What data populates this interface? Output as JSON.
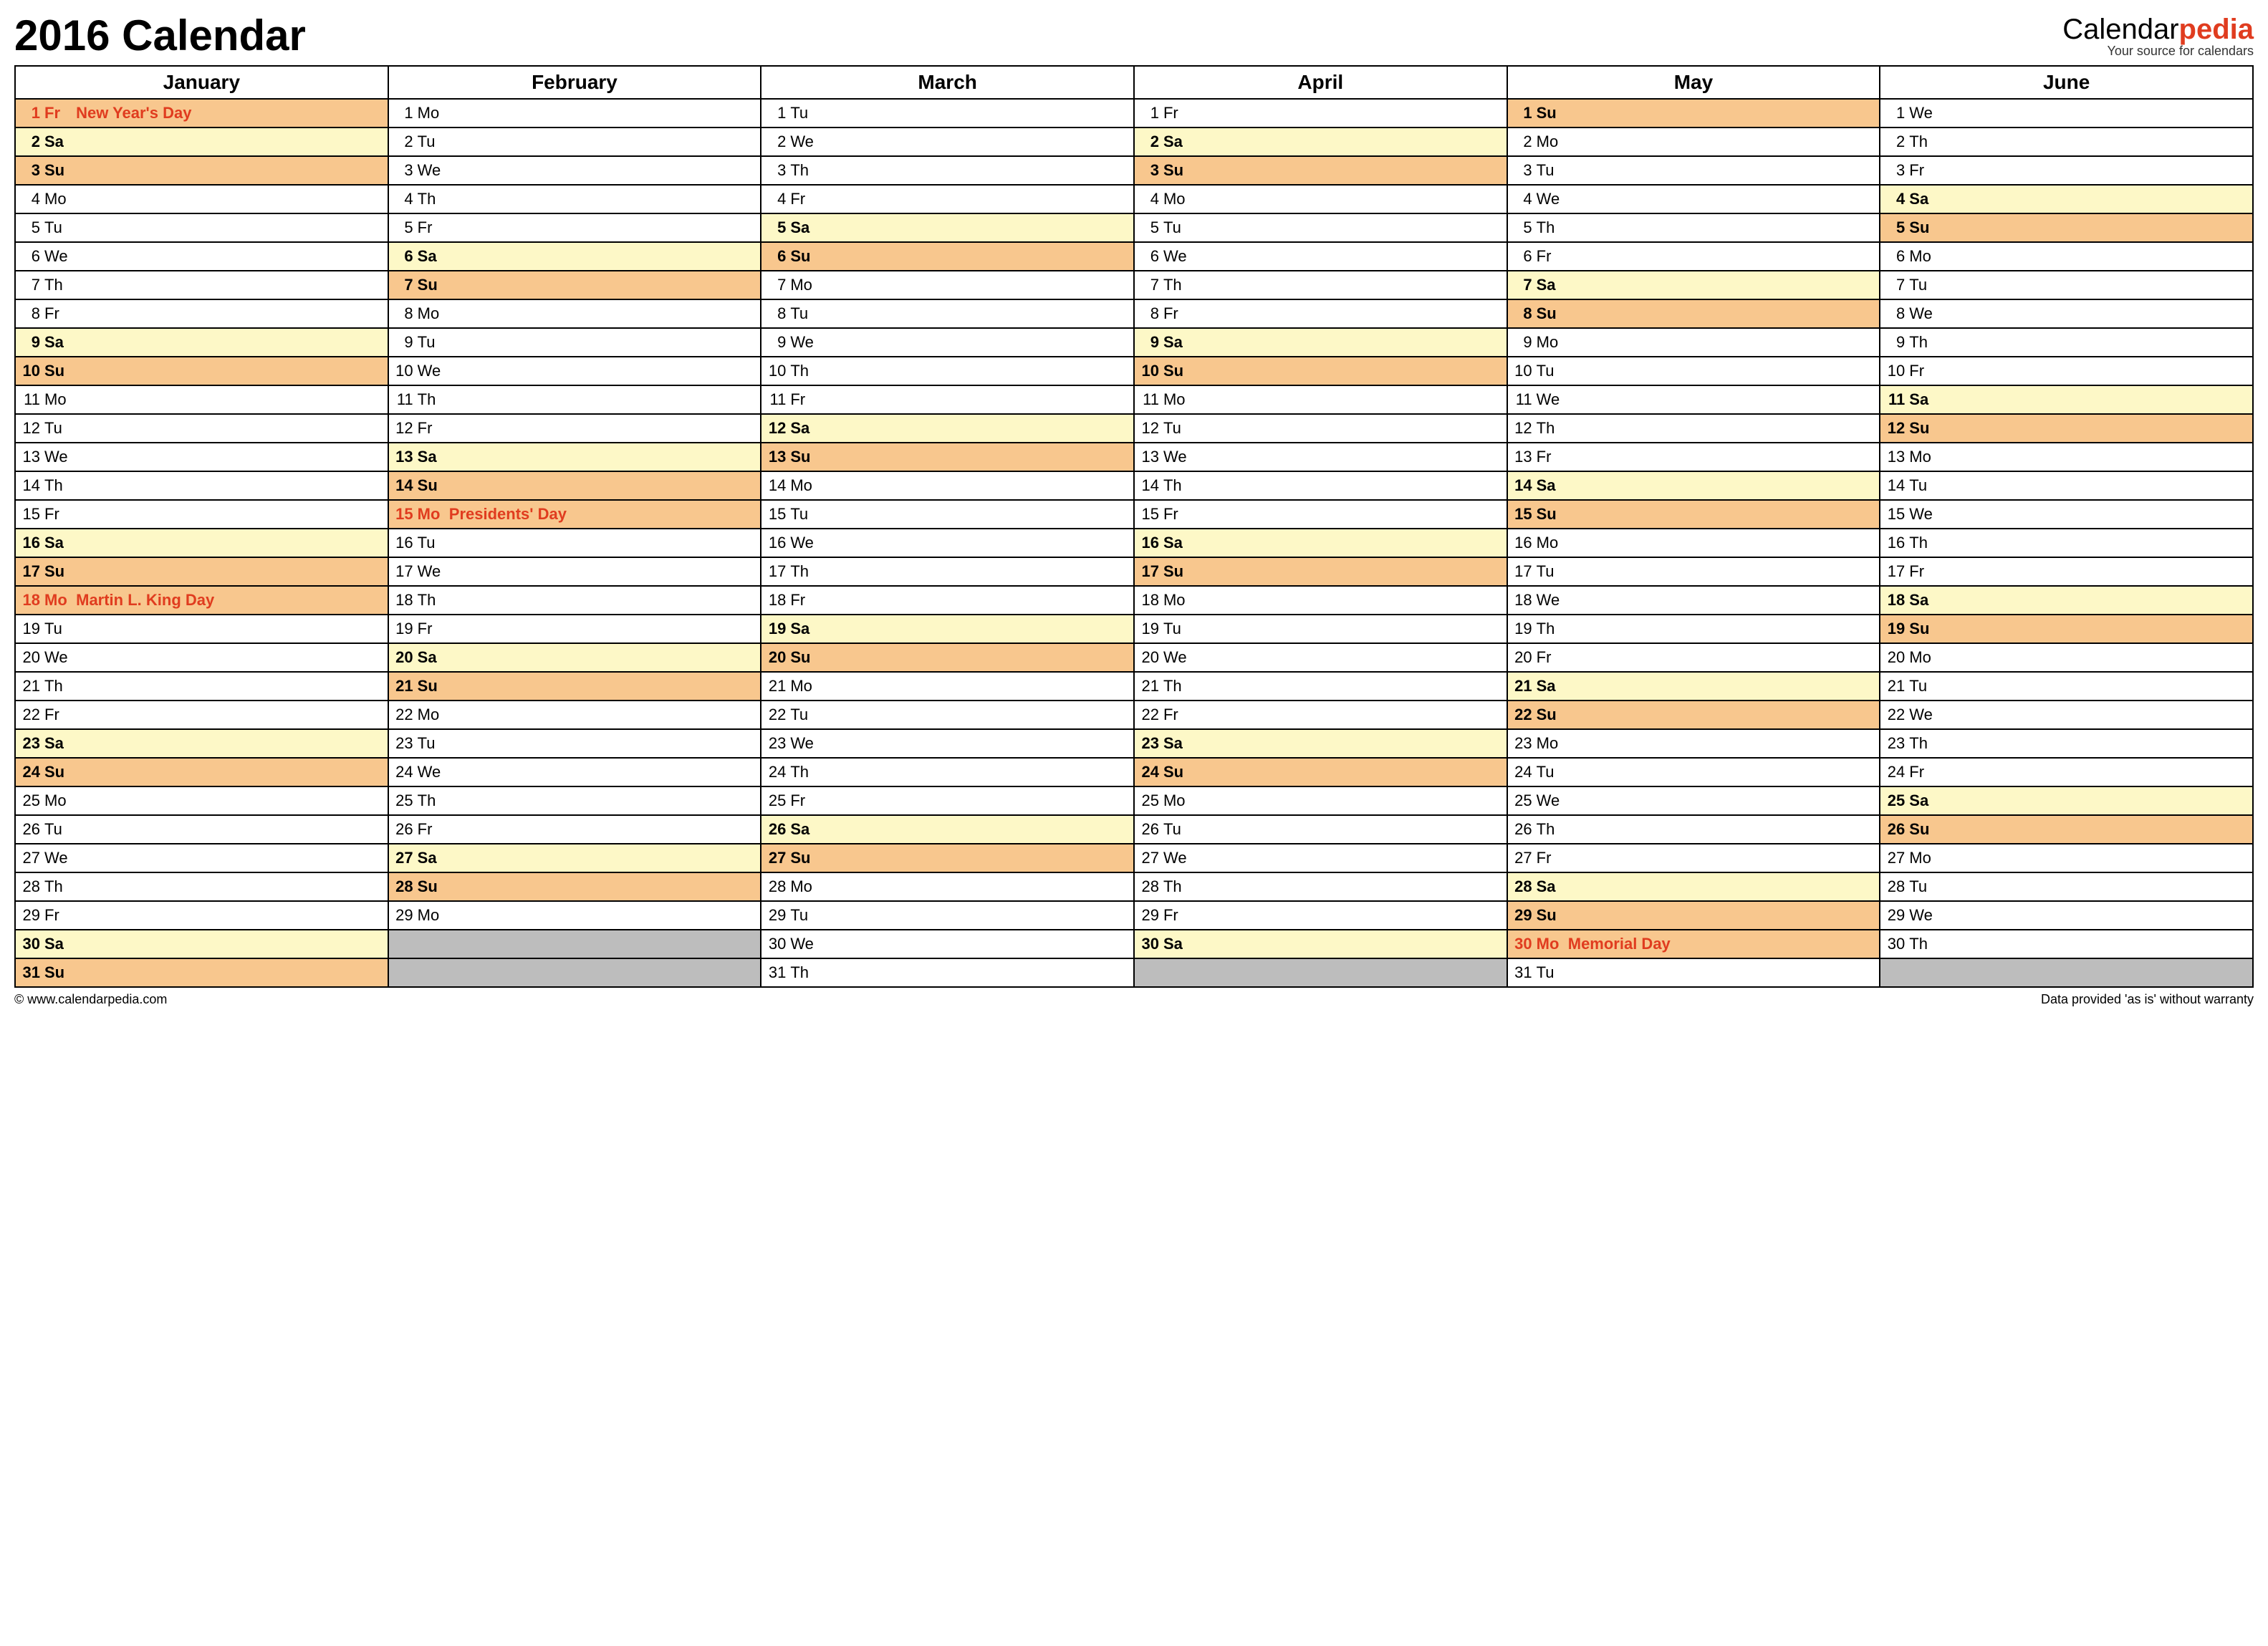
{
  "title": "2016 Calendar",
  "brand": {
    "part1": "Calendar",
    "part2": "pedia",
    "tagline": "Your source for calendars"
  },
  "footer": {
    "left": "© www.calendarpedia.com",
    "right": "Data provided 'as is' without warranty"
  },
  "dow": [
    "Mo",
    "Tu",
    "We",
    "Th",
    "Fr",
    "Sa",
    "Su"
  ],
  "months": [
    {
      "name": "January",
      "startDowIdx": 4,
      "numDays": 31,
      "holidays": {
        "1": "New Year's Day",
        "18": "Martin L. King Day"
      }
    },
    {
      "name": "February",
      "startDowIdx": 0,
      "numDays": 29,
      "holidays": {
        "15": "Presidents' Day"
      }
    },
    {
      "name": "March",
      "startDowIdx": 1,
      "numDays": 31,
      "holidays": {}
    },
    {
      "name": "April",
      "startDowIdx": 4,
      "numDays": 30,
      "holidays": {}
    },
    {
      "name": "May",
      "startDowIdx": 6,
      "numDays": 31,
      "holidays": {
        "30": "Memorial Day"
      }
    },
    {
      "name": "June",
      "startDowIdx": 2,
      "numDays": 30,
      "holidays": {}
    }
  ]
}
